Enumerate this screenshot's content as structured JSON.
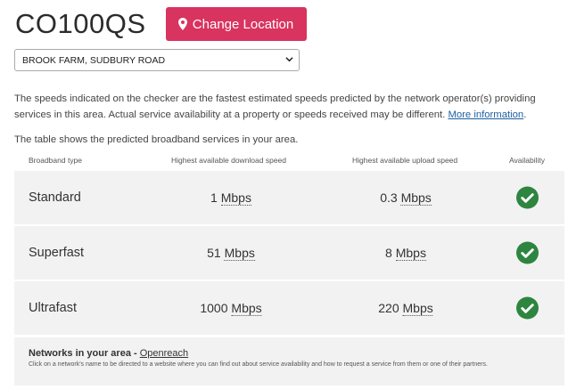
{
  "header": {
    "postcode": "CO100QS",
    "change_location_label": "Change Location"
  },
  "address_select": {
    "selected": "BROOK FARM, SUDBURY ROAD"
  },
  "info": {
    "text": "The speeds indicated on the checker are the fastest estimated speeds predicted by the network operator(s) providing services in this area. Actual service availability at a property or speeds received may be different. ",
    "link": "More information",
    "end": "."
  },
  "table_intro": "The table shows the predicted broadband services in your area.",
  "table": {
    "headers": {
      "type": "Broadband type",
      "download": "Highest available download speed",
      "upload": "Highest available upload speed",
      "availability": "Availability"
    },
    "rows": [
      {
        "type": "Standard",
        "download": "1",
        "download_unit": "Mbps",
        "upload": "0.3",
        "upload_unit": "Mbps",
        "available": true
      },
      {
        "type": "Superfast",
        "download": "51",
        "download_unit": "Mbps",
        "upload": "8",
        "upload_unit": "Mbps",
        "available": true
      },
      {
        "type": "Ultrafast",
        "download": "1000",
        "download_unit": "Mbps",
        "upload": "220",
        "upload_unit": "Mbps",
        "available": true
      }
    ]
  },
  "networks": {
    "title": "Networks in your area - ",
    "link": "Openreach",
    "note": "Click on a network's name to be directed to a website where you can find out about service availability and how to request a service from them or one of their partners."
  },
  "colors": {
    "accent": "#d9335f",
    "check_green": "#2e8540",
    "row_bg": "#f2f2f2",
    "link": "#1d5fa3"
  },
  "icons": {
    "location": "map-marker-icon",
    "dropdown": "chevron-down-icon",
    "available": "check-circle-icon"
  }
}
